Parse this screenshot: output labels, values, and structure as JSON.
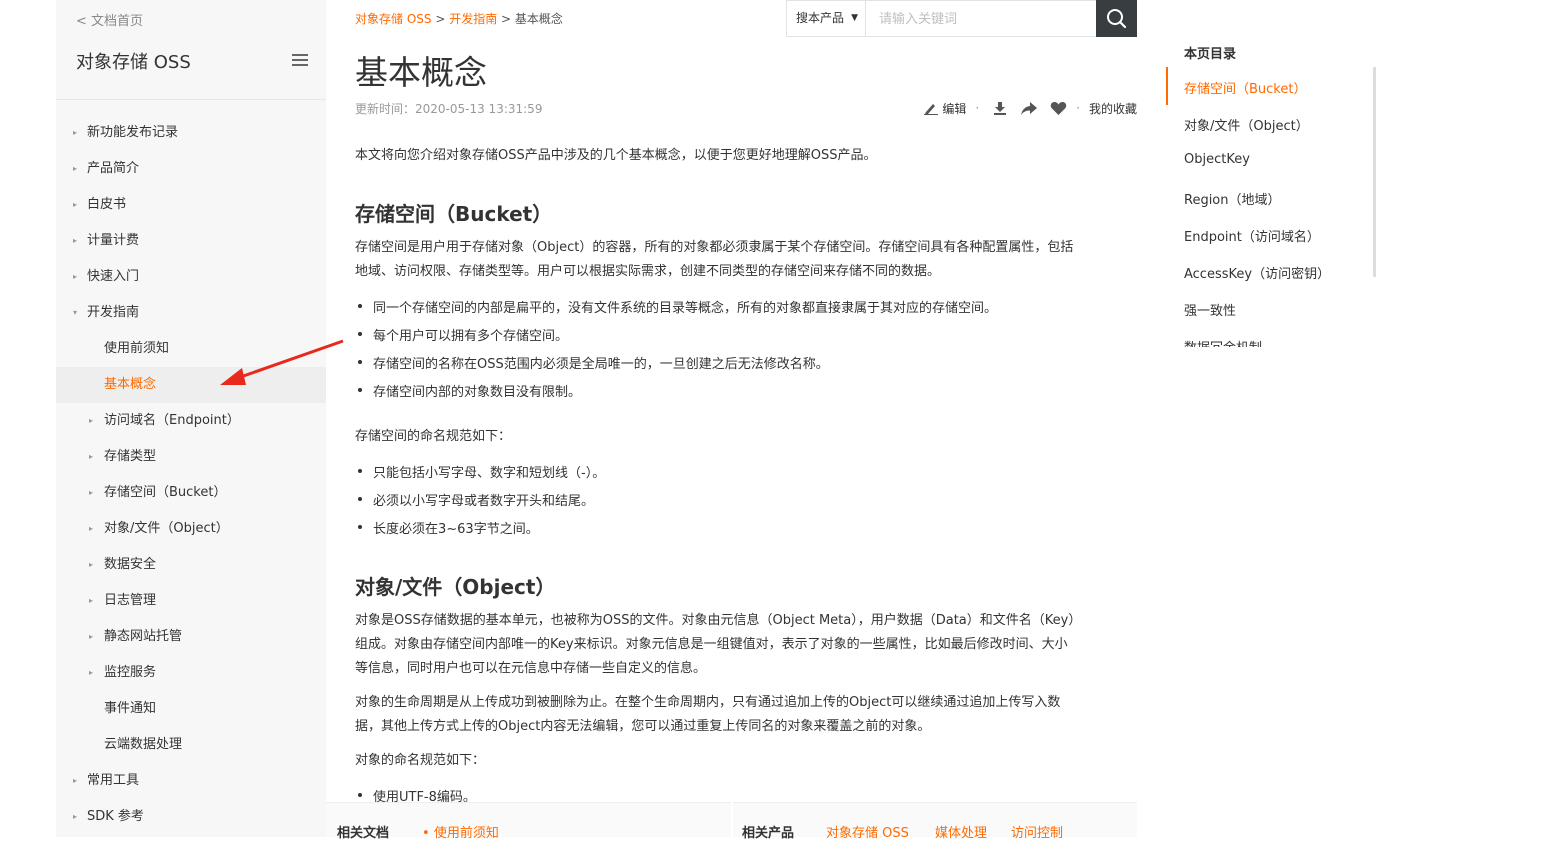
{
  "sidebar": {
    "back_label": "< 文档首页",
    "product_title": "对象存储 OSS",
    "items": [
      {
        "label": "新功能发布记录",
        "level": 1,
        "arrow": "▸"
      },
      {
        "label": "产品简介",
        "level": 1,
        "arrow": "▸"
      },
      {
        "label": "白皮书",
        "level": 1,
        "arrow": "▸"
      },
      {
        "label": "计量计费",
        "level": 1,
        "arrow": "▸"
      },
      {
        "label": "快速入门",
        "level": 1,
        "arrow": "▸"
      },
      {
        "label": "开发指南",
        "level": 1,
        "arrow": "▾"
      },
      {
        "label": "使用前须知",
        "level": 2,
        "arrow": ""
      },
      {
        "label": "基本概念",
        "level": 2,
        "arrow": "",
        "active": true
      },
      {
        "label": "访问域名（Endpoint）",
        "level": 2,
        "arrow": "▸"
      },
      {
        "label": "存储类型",
        "level": 2,
        "arrow": "▸"
      },
      {
        "label": "存储空间（Bucket）",
        "level": 2,
        "arrow": "▸"
      },
      {
        "label": "对象/文件（Object）",
        "level": 2,
        "arrow": "▸"
      },
      {
        "label": "数据安全",
        "level": 2,
        "arrow": "▸"
      },
      {
        "label": "日志管理",
        "level": 2,
        "arrow": "▸"
      },
      {
        "label": "静态网站托管",
        "level": 2,
        "arrow": "▸"
      },
      {
        "label": "监控服务",
        "level": 2,
        "arrow": "▸"
      },
      {
        "label": "事件通知",
        "level": 2,
        "arrow": ""
      },
      {
        "label": "云端数据处理",
        "level": 2,
        "arrow": ""
      },
      {
        "label": "常用工具",
        "level": 1,
        "arrow": "▸"
      },
      {
        "label": "SDK 参考",
        "level": 1,
        "arrow": "▸"
      }
    ]
  },
  "breadcrumb": {
    "item1": "对象存储 OSS",
    "sep": " > ",
    "item2": "开发指南",
    "current": "基本概念"
  },
  "search": {
    "scope": "搜本产品",
    "placeholder": "请输入关键词"
  },
  "page": {
    "title": "基本概念",
    "update_time": "更新时间：2020-05-13 13:31:59"
  },
  "toolbar": {
    "edit": "编辑",
    "favorites": "我的收藏"
  },
  "content": {
    "intro": "本文将向您介绍对象存储OSS产品中涉及的几个基本概念，以便于您更好地理解OSS产品。",
    "bucket_heading": "存储空间（Bucket）",
    "bucket_desc_line1": "存储空间是用户用于存储对象（Object）的容器，所有的对象都必须隶属于某个存储空间。存储空间具有各种配置属性，包括",
    "bucket_desc_line2": "地域、访问权限、存储类型等。用户可以根据实际需求，创建不同类型的存储空间来存储不同的数据。",
    "bucket_bullets": [
      "同一个存储空间的内部是扁平的，没有文件系统的目录等概念，所有的对象都直接隶属于其对应的存储空间。",
      "每个用户可以拥有多个存储空间。",
      "存储空间的名称在OSS范围内必须是全局唯一的，一旦创建之后无法修改名称。",
      "存储空间内部的对象数目没有限制。"
    ],
    "naming_intro": "存储空间的命名规范如下：",
    "naming_bullets": [
      "只能包括小写字母、数字和短划线（-）。",
      "必须以小写字母或者数字开头和结尾。",
      "长度必须在3~63字节之间。"
    ],
    "object_heading": "对象/文件（Object）",
    "object_desc_line1": "对象是OSS存储数据的基本单元，也被称为OSS的文件。对象由元信息（Object Meta），用户数据（Data）和文件名（Key）",
    "object_desc_line2": "组成。对象由存储空间内部唯一的Key来标识。对象元信息是一组键值对，表示了对象的一些属性，比如最后修改时间、大小",
    "object_desc_line3": "等信息，同时用户也可以在元信息中存储一些自定义的信息。",
    "lifecycle_line1": "对象的生命周期是从上传成功到被删除为止。在整个生命周期内，只有通过追加上传的Object可以继续通过追加上传写入数",
    "lifecycle_line2": "据，其他上传方式上传的Object内容无法编辑，您可以通过重复上传同名的对象来覆盖之前的对象。",
    "object_naming_intro": "对象的命名规范如下：",
    "object_bullets": [
      "使用UTF-8编码。"
    ]
  },
  "footer": {
    "related_docs_label": "相关文档",
    "related_docs_link": "使用前须知",
    "related_products_label": "相关产品",
    "products": [
      "对象存储 OSS",
      "媒体处理",
      "访问控制"
    ]
  },
  "toc": {
    "title": "本页目录",
    "items": [
      {
        "label": "存储空间（Bucket）",
        "active": true
      },
      {
        "label": "对象/文件（Object）"
      },
      {
        "label": "ObjectKey"
      },
      {
        "label": "Region（地域）"
      },
      {
        "label": "Endpoint（访问域名）"
      },
      {
        "label": "AccessKey（访问密钥）"
      },
      {
        "label": "强一致性"
      },
      {
        "label": "数据冗余机制"
      }
    ]
  },
  "colors": {
    "accent": "#ff6a00",
    "search_button": "#373d41",
    "sidebar_bg": "#f7f7f7"
  },
  "icons": [
    "hamburger-icon",
    "search-icon",
    "edit-icon",
    "download-icon",
    "share-icon",
    "heart-icon",
    "red-arrow-annotation"
  ]
}
